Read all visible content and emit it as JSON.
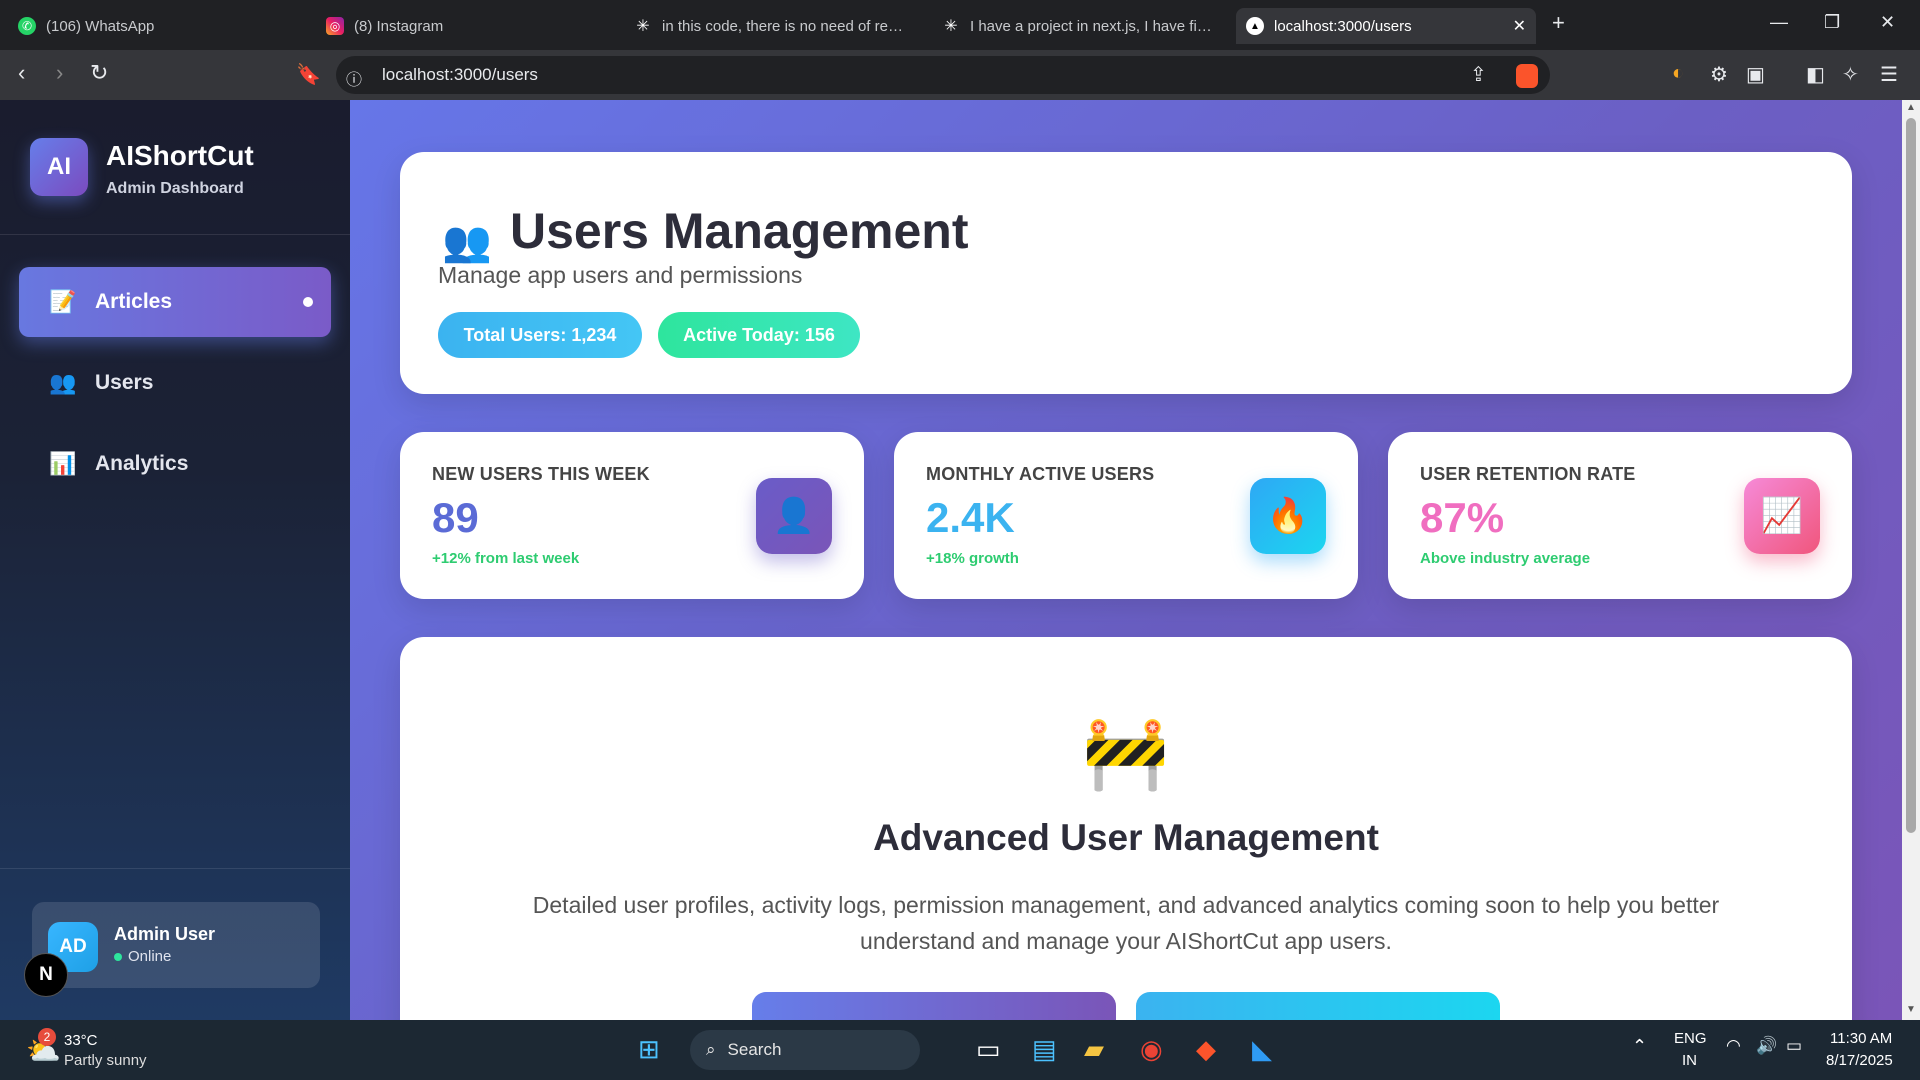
{
  "browser": {
    "tabs": [
      {
        "title": "(106) WhatsApp",
        "icon": "whatsapp-icon"
      },
      {
        "title": "(8) Instagram",
        "icon": "instagram-icon"
      },
      {
        "title": "in this code, there is no need of read",
        "icon": "openai-icon"
      },
      {
        "title": "I have a project in next.js, I have fireb",
        "icon": "openai-icon"
      },
      {
        "title": "localhost:3000/users",
        "icon": "vercel-icon"
      }
    ],
    "url": "localhost:3000/users"
  },
  "sidebar": {
    "logo": "AI",
    "brand": "AIShortCut",
    "brand_sub": "Admin Dashboard",
    "items": [
      {
        "label": "Articles",
        "icon": "📝"
      },
      {
        "label": "Users",
        "icon": "👥"
      },
      {
        "label": "Analytics",
        "icon": "📊"
      }
    ],
    "user": {
      "initials": "AD",
      "name": "Admin User",
      "status": "Online"
    },
    "floating_badge": "N"
  },
  "header": {
    "icon": "👥",
    "title": "Users Management",
    "subtitle": "Manage app users and permissions",
    "pill_total": "Total Users: 1,234",
    "pill_active": "Active Today: 156"
  },
  "stats": [
    {
      "label": "NEW USERS THIS WEEK",
      "value": "89",
      "change": "+12% from last week",
      "icon": "👤",
      "value_color": "#5b6bd6"
    },
    {
      "label": "MONTHLY ACTIVE USERS",
      "value": "2.4K",
      "change": "+18% growth",
      "icon": "🔥",
      "value_color": "#3bb3f0"
    },
    {
      "label": "USER RETENTION RATE",
      "value": "87%",
      "change": "Above industry average",
      "icon": "📈",
      "value_color": "#f06ec0"
    }
  ],
  "feature": {
    "icon": "🚧",
    "title": "Advanced User Management",
    "description": "Detailed user profiles, activity logs, permission management, and advanced analytics coming soon to help you better understand and manage your AIShortCut app users."
  },
  "taskbar": {
    "weather_temp": "33°C",
    "weather_desc": "Partly sunny",
    "weather_badge": "2",
    "search": "Search",
    "lang": "ENG",
    "region": "IN",
    "time": "11:30 AM",
    "date": "8/17/2025"
  },
  "colors": {
    "accent": "#667eea",
    "accent2": "#764ba2",
    "success": "#2ecc71"
  }
}
